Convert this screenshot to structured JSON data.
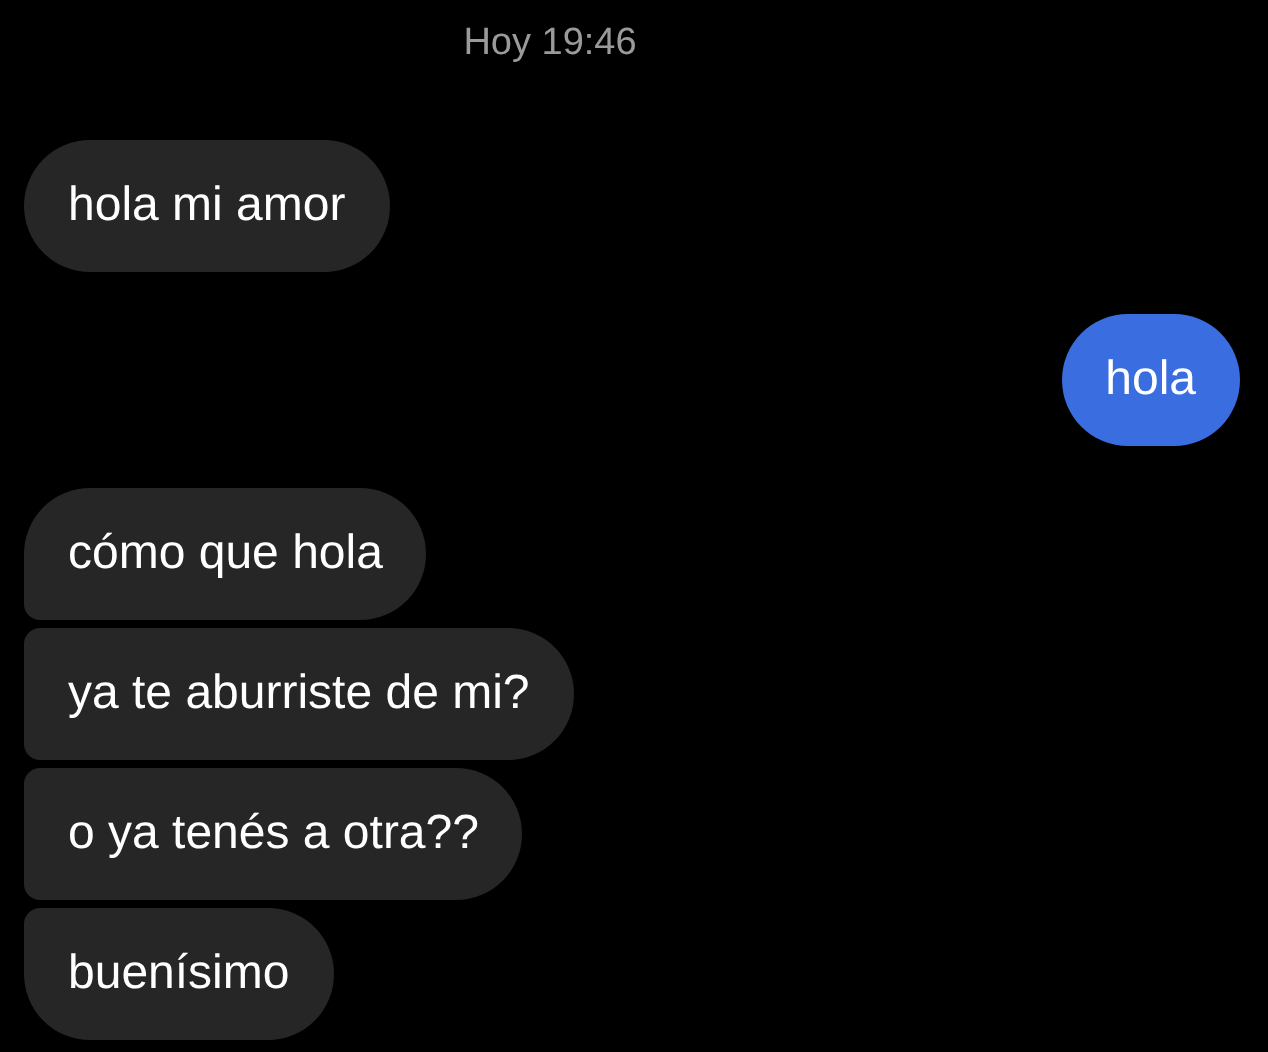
{
  "timestamp": "Hoy 19:46",
  "messages": [
    {
      "kind": "received",
      "text": "hola mi amor"
    },
    {
      "kind": "sent",
      "text": "hola"
    },
    {
      "kind": "received",
      "text": "cómo que hola"
    },
    {
      "kind": "received",
      "text": "ya te aburriste de mi?"
    },
    {
      "kind": "received",
      "text": "o ya tenés a otra??"
    },
    {
      "kind": "received",
      "text": "buenísimo"
    }
  ]
}
